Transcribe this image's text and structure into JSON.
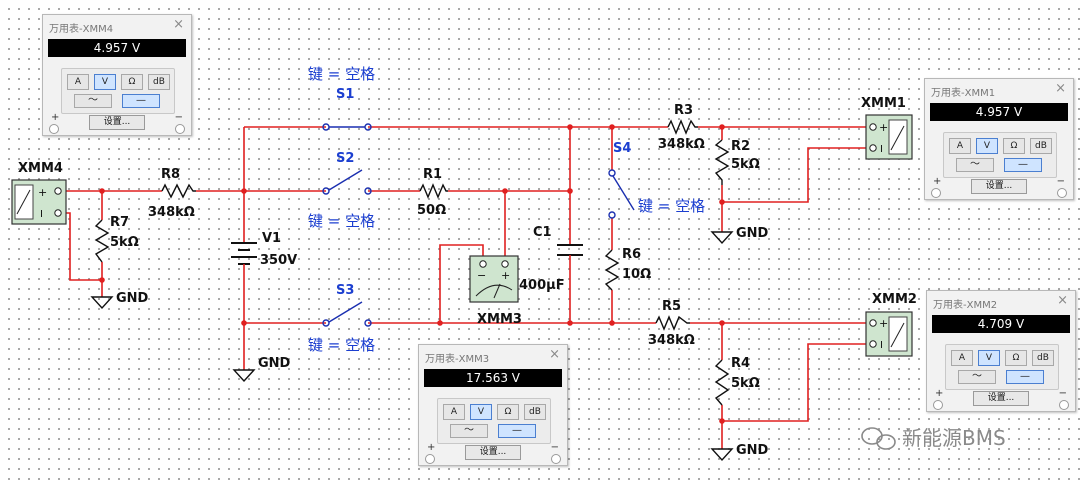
{
  "labels": {
    "S1": "S1",
    "S2": "S2",
    "S3": "S3",
    "S4": "S4",
    "key_s1": "键 = 空格",
    "key_s2": "键 = 空格",
    "key_s3": "键 = 空格",
    "key_s4": "键 = 空格",
    "R1": "R1",
    "R1_val": "50Ω",
    "R2": "R2",
    "R2_val": "5kΩ",
    "R3": "R3",
    "R3_val": "348kΩ",
    "R4": "R4",
    "R4_val": "5kΩ",
    "R5": "R5",
    "R5_val": "348kΩ",
    "R6": "R6",
    "R6_val": "10Ω",
    "R7": "R7",
    "R7_val": "5kΩ",
    "R8": "R8",
    "R8_val": "348kΩ",
    "C1": "C1",
    "C1_val": "400μF",
    "V1": "V1",
    "V1_val": "350V",
    "XMM1": "XMM1",
    "XMM2": "XMM2",
    "XMM3": "XMM3",
    "XMM4": "XMM4",
    "gnd1": "GND",
    "gnd2": "GND",
    "gnd3": "GND",
    "gnd4": "GND"
  },
  "panels": [
    {
      "title": "万用表-XMM4",
      "reading": "4.957 V"
    },
    {
      "title": "万用表-XMM1",
      "reading": "4.957 V"
    },
    {
      "title": "万用表-XMM2",
      "reading": "4.709 V"
    },
    {
      "title": "万用表-XMM3",
      "reading": "17.563 V"
    }
  ],
  "panel_ui": {
    "close": "×",
    "mode_a": "A",
    "mode_v": "V",
    "mode_ohm": "Ω",
    "mode_db": "dB",
    "ac": "〜",
    "dc": "—",
    "settings": "设置...",
    "plus": "+",
    "minus": "−",
    "selected_mode": "V",
    "selected_wave": "dc"
  },
  "meter_glyph": {
    "plus": "+",
    "minus": "−",
    "i": "I"
  },
  "watermark": "新能源BMS",
  "colors": {
    "wire": "#e02020",
    "switch": "#1a2fb0",
    "key_text": "#1c3fd0",
    "meter_body": "#cfe5cf"
  }
}
